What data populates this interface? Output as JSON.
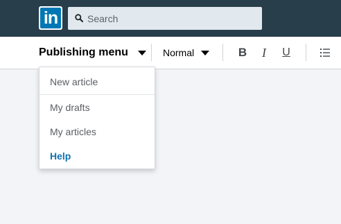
{
  "header": {
    "logo_text": "in",
    "search": {
      "placeholder": "Search",
      "icon": "search-icon"
    }
  },
  "toolbar": {
    "publishing_menu_label": "Publishing menu",
    "text_style": "Normal",
    "format_buttons": {
      "bold": "B",
      "italic": "I",
      "underline": "U"
    },
    "list_icon": "bulleted-list-icon"
  },
  "publishing_menu": {
    "items": [
      {
        "label": "New article"
      },
      {
        "label": "My drafts"
      },
      {
        "label": "My articles"
      },
      {
        "label": "Help"
      }
    ]
  },
  "colors": {
    "topbar": "#283e4a",
    "brand": "#0077b5",
    "link": "#0f73b1",
    "background": "#f3f4f7"
  }
}
